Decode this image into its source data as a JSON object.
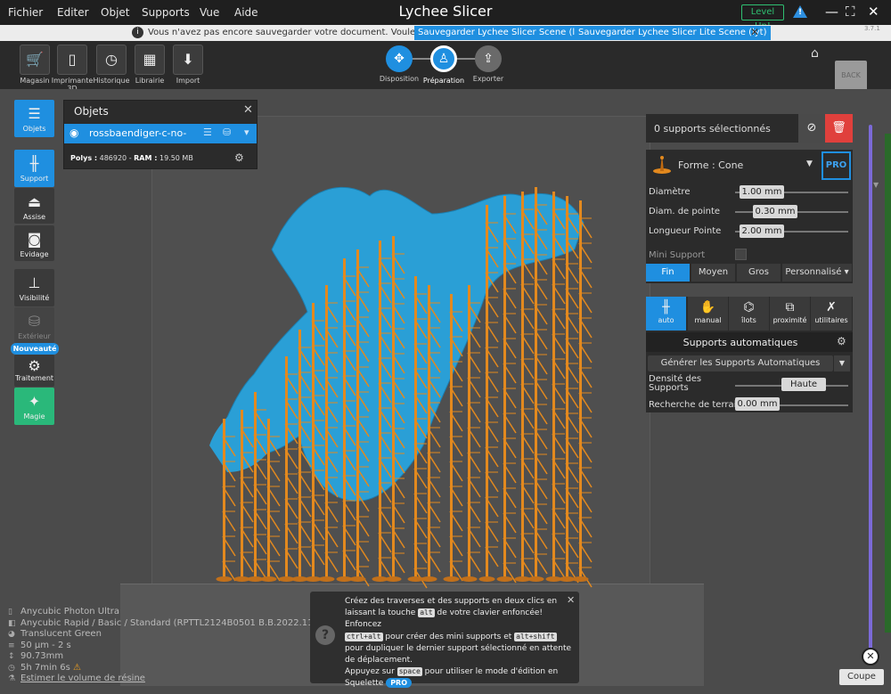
{
  "menu": [
    "Fichier",
    "Editer",
    "Objet",
    "Supports",
    "Vue",
    "Aide"
  ],
  "app_title": "Lychee Slicer",
  "level_up": "Level Up!",
  "window_controls": [
    "—",
    "⛶",
    "✕"
  ],
  "version": "3.7.1",
  "notification": {
    "message": "Vous n'avez pas encore sauvegarder votre document. Voulez-vous :",
    "save_lys": "Sauvegarder Lychee Slicer Scene (lys)",
    "save_lyt": "Sauvegarder Lychee Slicer Lite Scene (lyt)"
  },
  "toolbar": {
    "items": [
      "Magasin",
      "Imprimante 3D",
      "Historique",
      "Librairie",
      "Import"
    ],
    "steps": [
      "Disposition",
      "Préparation",
      "Exporter"
    ],
    "back": "BACK"
  },
  "sidebar": {
    "objets": "Objets",
    "support": "Support",
    "assise": "Assise",
    "evidage": "Evidage",
    "visibilite": "Visibilité",
    "exterieur": "Extérieur",
    "nouveaute": "Nouveauté",
    "traitement": "Traitement",
    "magie": "Magie"
  },
  "objects_panel": {
    "title": "Objets",
    "object_name": "rossbaendiger-c-no-",
    "polys_label": "Polys :",
    "polys": "486920",
    "ram_label": "RAM :",
    "ram": "19.50 MB"
  },
  "selection": {
    "text": "0 supports sélectionnés"
  },
  "shape": {
    "label": "Forme : Cone",
    "pro": "PRO",
    "params": [
      {
        "label": "Diamètre",
        "value": "1.00 mm"
      },
      {
        "label": "Diam. de pointe",
        "value": "0.30 mm"
      },
      {
        "label": "Longueur Pointe",
        "value": "2.00 mm"
      }
    ],
    "mini_support": "Mini Support",
    "sizes": [
      "Fin",
      "Moyen",
      "Gros",
      "Personnalisé ▾"
    ]
  },
  "modes": [
    "auto",
    "manual",
    "îlots",
    "proximité",
    "utilitaires"
  ],
  "auto": {
    "title": "Supports automatiques",
    "generate": "Générer les Supports Automatiques",
    "density_label": "Densité des Supports",
    "density_value": "Haute",
    "terrain_label": "Recherche de terrain",
    "terrain_value": "0.00 mm"
  },
  "coupe": "Coupe",
  "printer_info": {
    "printer": "Anycubic Photon Ultra",
    "profile": "Anycubic Rapid / Basic / Standard (RPTTL2124B0501 B.B.2022.11.12)",
    "resin": "Translucent Green",
    "layer": "50 µm - 2 s",
    "height": "90.73mm",
    "time": "5h 7min 6s",
    "estimate": "Estimer le volume de résine"
  },
  "tip": {
    "l1": "Créez des traverses et des supports en deux clics en",
    "l2a": "laissant la touche",
    "k1": "alt",
    "l2b": "de votre clavier enfoncée! Enfoncez",
    "k2": "ctrl+alt",
    "l3a": "pour créer des mini supports et",
    "k3": "alt+shift",
    "l4": "pour dupliquer le dernier support sélectionné en attente de déplacement.",
    "l5a": "Appuyez sur",
    "k4": "space",
    "l5b": "pour utiliser le mode d'édition en",
    "l6": "Squelette",
    "pro": "PRO"
  },
  "colors": {
    "accent": "#1f8fe0",
    "support": "#e3891e",
    "model": "#2a9fd6",
    "delete": "#e0403c",
    "magic": "#2ab87a"
  }
}
